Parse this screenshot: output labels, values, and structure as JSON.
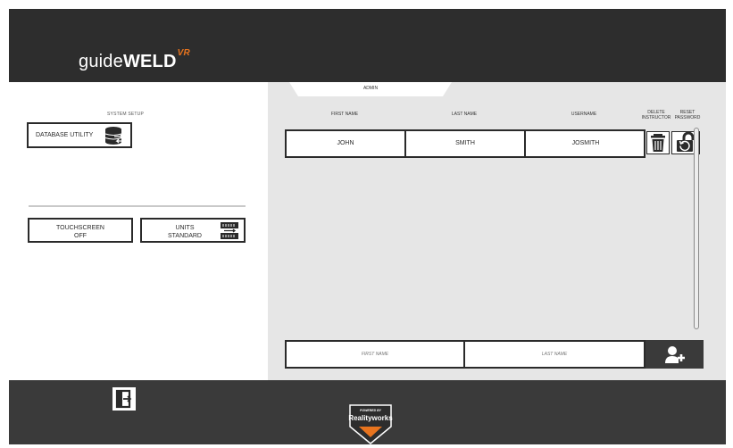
{
  "header": {
    "logo_guide": "guide",
    "logo_weld": "WELD",
    "logo_vr": "VR"
  },
  "left_panel": {
    "section_label": "SYSTEM SETUP",
    "database_utility": "DATABASE UTILITY",
    "touchscreen_label": "TOUCHSCREEN",
    "touchscreen_value": "OFF",
    "units_label": "UNITS",
    "units_value": "STANDARD"
  },
  "main": {
    "tab_label": "ADMIN",
    "columns": {
      "first_name": "FIRST NAME",
      "last_name": "LAST NAME",
      "username": "USERNAME",
      "delete_line1": "DELETE",
      "delete_line2": "INSTRUCTOR",
      "reset_line1": "RESET",
      "reset_line2": "PASSWORD"
    },
    "rows": [
      {
        "first_name": "JOHN",
        "last_name": "SMITH",
        "username": "JOSMITH"
      }
    ],
    "add_form": {
      "first_name_placeholder": "FIRST NAME",
      "last_name_placeholder": "LAST NAME"
    }
  },
  "footer": {
    "powered_by": "POWERED BY",
    "brand": "Realityworks"
  },
  "colors": {
    "header_bg": "#2d2d2d",
    "footer_bg": "#3a3a3a",
    "panel_bg": "#e6e6e6",
    "accent": "#e8741e"
  },
  "icons": [
    "database-icon",
    "units-toggle-icon",
    "trash-icon",
    "unlock-icon",
    "add-user-icon",
    "exit-door-icon",
    "realityworks-logo"
  ]
}
